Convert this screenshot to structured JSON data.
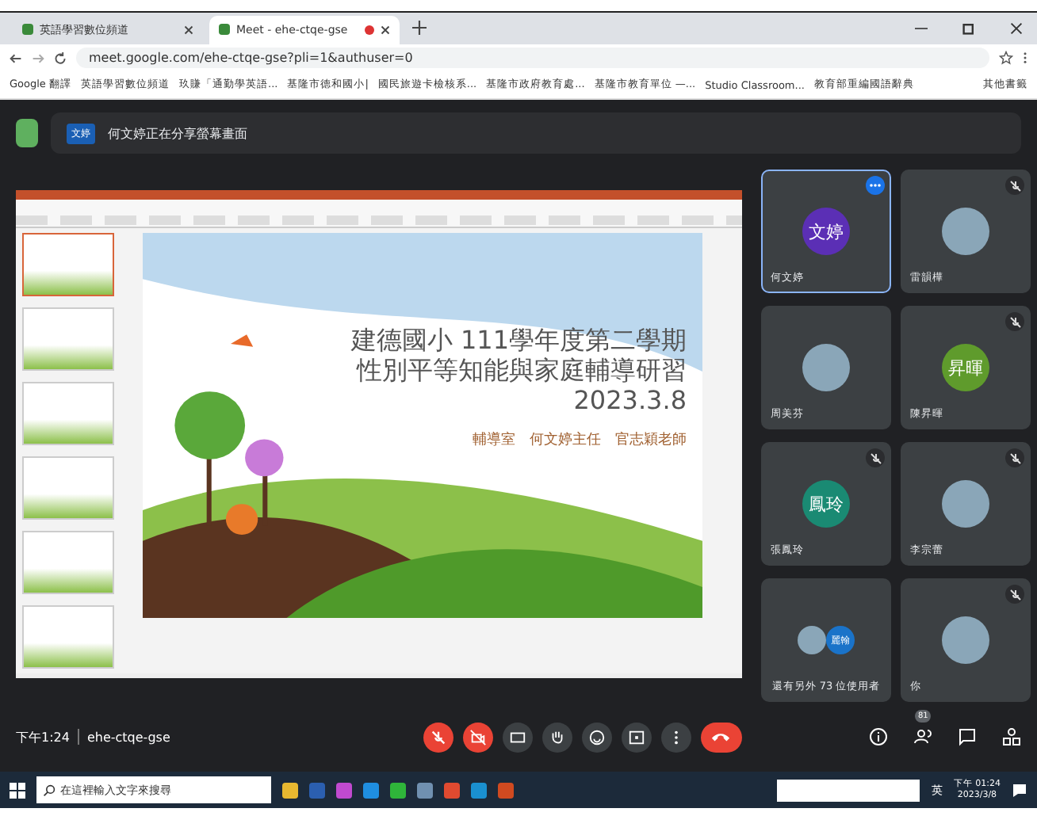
{
  "browser": {
    "tabs": [
      {
        "title": "英語學習數位頻道",
        "selected": false,
        "recording": false
      },
      {
        "title": "Meet - ehe-ctqe-gse",
        "selected": true,
        "recording": true
      }
    ],
    "url": "meet.google.com/ehe-ctqe-gse?pli=1&authuser=0",
    "bookmarks": [
      "Google 翻譯",
      "英語學習數位頻道",
      "玖賺「通勤學英語...",
      "基隆市德和國小|",
      "國民旅遊卡檢核系...",
      "基隆市政府教育處...",
      "基隆市教育單位 —...",
      "Studio Classroom...",
      "教育部重編國語辭典"
    ],
    "other_bookmarks": "其他書籤"
  },
  "presenter_bar": {
    "badge": "文婷",
    "text": "何文婷正在分享螢幕畫面"
  },
  "slide": {
    "title_lines": [
      "建德國小 111學年度第二學期",
      "性別平等知能與家庭輔導研習",
      "2023.3.8"
    ],
    "presenters": "輔導室　何文婷主任　官志穎老師"
  },
  "thumbnails": [
    {
      "selected": true
    },
    {
      "selected": false
    },
    {
      "selected": false
    },
    {
      "selected": false
    },
    {
      "selected": false
    },
    {
      "selected": false
    }
  ],
  "participants": [
    {
      "name": "何文婷",
      "kind": "initials",
      "initials": "文婷",
      "color": "#5b2fb5",
      "muted": false,
      "highlighted": true
    },
    {
      "name": "雷韻樺",
      "kind": "photo",
      "muted": true,
      "highlighted": false
    },
    {
      "name": "周美芬",
      "kind": "photo",
      "muted": false,
      "highlighted": false
    },
    {
      "name": "陳昇暉",
      "kind": "initials",
      "initials": "昇暉",
      "color": "#5f9b2c",
      "muted": true,
      "highlighted": false
    },
    {
      "name": "張鳳玲",
      "kind": "initials",
      "initials": "鳳玲",
      "color": "#1a8a73",
      "muted": true,
      "highlighted": false
    },
    {
      "name": "李宗蕾",
      "kind": "photo",
      "muted": true,
      "highlighted": false
    },
    {
      "name": "還有另外 73 位使用者",
      "kind": "others",
      "initials": "麗翰",
      "color": "#1a73c9",
      "muted": false,
      "highlighted": false
    },
    {
      "name": "你",
      "kind": "photo",
      "muted": true,
      "highlighted": false
    }
  ],
  "meeting": {
    "time": "下午1:24",
    "code": "ehe-ctqe-gse",
    "people_count": "81"
  },
  "taskbar": {
    "search_placeholder": "在這裡輸入文字來搜尋",
    "ime": "英",
    "time": "下午 01:24",
    "date": "2023/3/8"
  }
}
